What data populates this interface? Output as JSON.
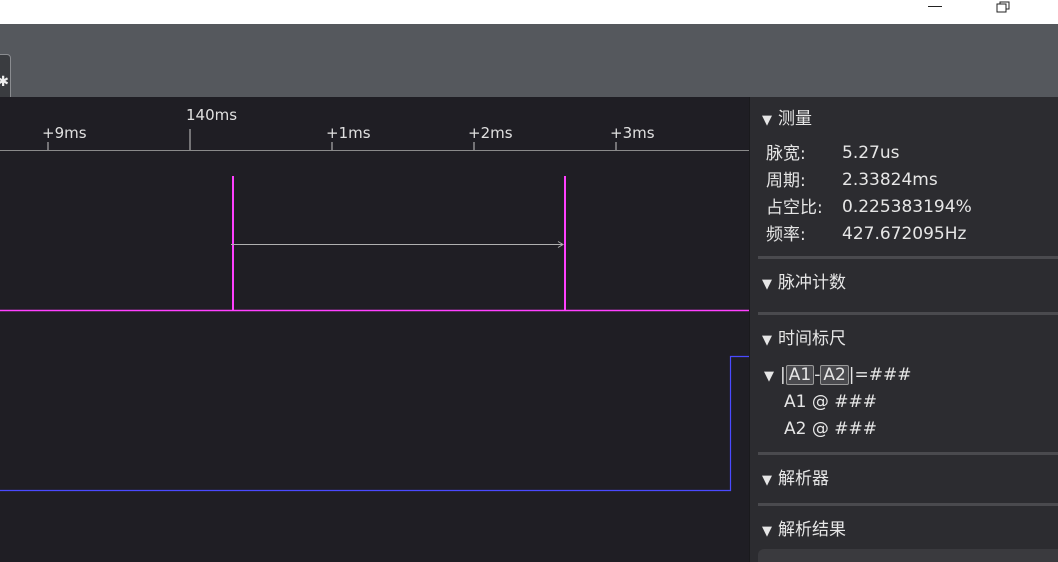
{
  "timeline": {
    "ticks": [
      {
        "label": "+9ms"
      },
      {
        "label": "140ms"
      },
      {
        "label": "+1ms"
      },
      {
        "label": "+2ms"
      },
      {
        "label": "+3ms"
      }
    ]
  },
  "panel": {
    "measure": {
      "title": "测量",
      "rows": [
        {
          "label": "脉宽:",
          "value": "5.27us"
        },
        {
          "label": "周期:",
          "value": "2.33824ms"
        },
        {
          "label": "占空比:",
          "value": "0.225383194%"
        },
        {
          "label": "频率:",
          "value": "427.672095Hz"
        }
      ]
    },
    "pulse_count": {
      "title": "脉冲计数"
    },
    "time_ruler": {
      "title": "时间标尺",
      "pipe1": "|",
      "a1": "A1",
      "dash": "-",
      "a2": "A2",
      "eq": "|=###",
      "a1_line": "A1 @ ###",
      "a2_line": "A2 @ ###"
    },
    "parser": {
      "title": "解析器"
    },
    "parse_result": {
      "title": "解析结果"
    }
  },
  "colors": {
    "marker": "#ff40ff",
    "channel2": "#4a4aff",
    "background": "#1f1e24"
  }
}
